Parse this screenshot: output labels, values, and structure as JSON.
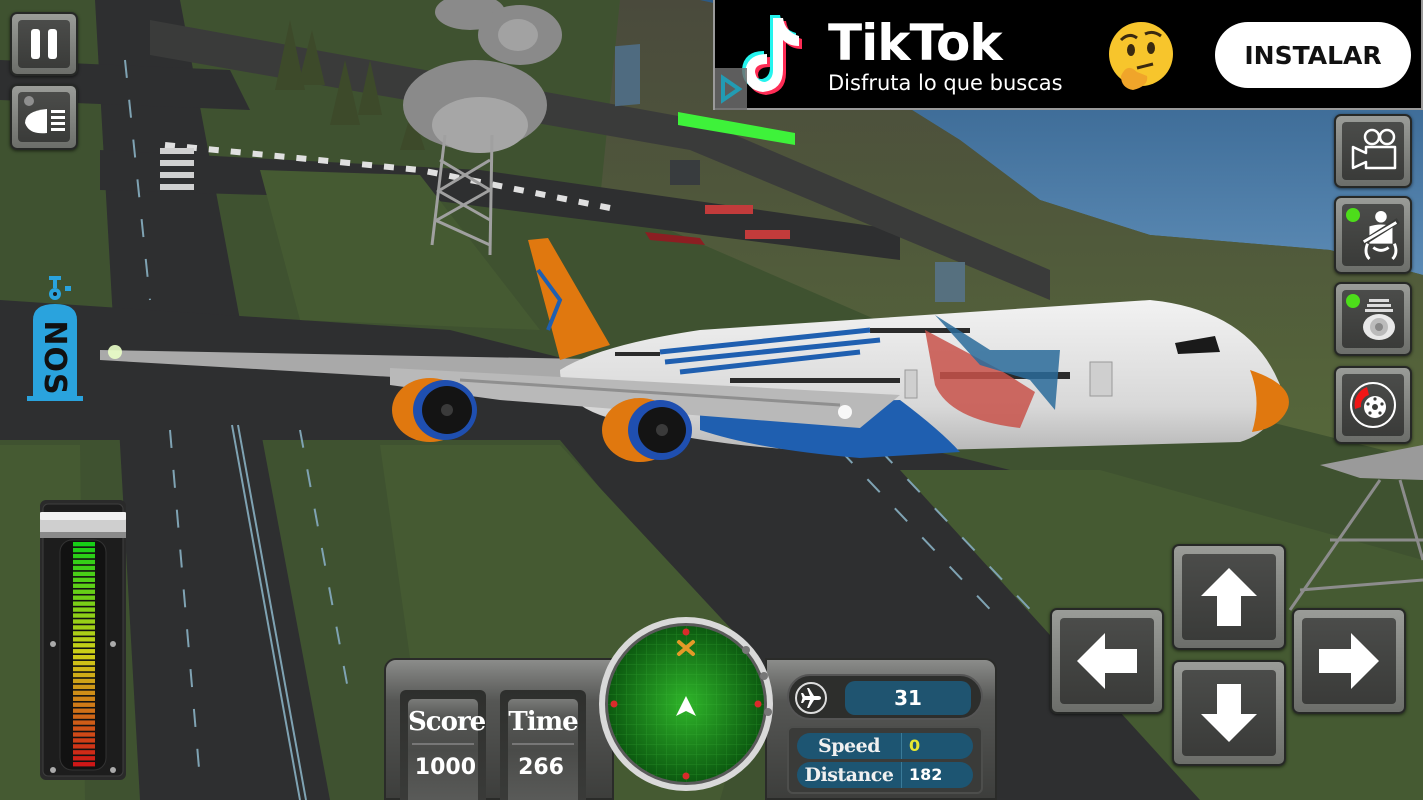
{
  "hud": {
    "pause_icon": "pause-icon",
    "headlight_icon": "headlight-icon",
    "nos_label": "NOS",
    "nos_icon": "nitro-bottle-icon",
    "throttle_level": 1.0
  },
  "ad": {
    "brand": "TikTok",
    "tagline": "Disfruta lo que buscas",
    "emoji": "thinking-face",
    "install_label": "INSTALAR",
    "logo_icon": "tiktok-logo-icon",
    "adchoices_icon": "adchoices-play-icon"
  },
  "right_controls": [
    {
      "name": "camera-button",
      "icon": "video-camera-icon",
      "active_indicator": false
    },
    {
      "name": "seatbelt-button",
      "icon": "seatbelt-icon",
      "active_indicator": true
    },
    {
      "name": "landing-gear-button",
      "icon": "landing-gear-icon",
      "active_indicator": true
    },
    {
      "name": "brake-button",
      "icon": "brake-disc-icon",
      "active_indicator": false
    }
  ],
  "dashboard": {
    "score_label": "Score",
    "score_value": "1000",
    "time_label": "Time",
    "time_value": "266",
    "altitude_value": "31",
    "speed_label": "Speed",
    "speed_value": "0",
    "distance_label": "Distance",
    "distance_value": "182"
  },
  "radar": {
    "target_marker": "x-target-icon",
    "player_marker": "player-arrow-icon"
  },
  "dpad": {
    "up": "arrow-up-icon",
    "down": "arrow-down-icon",
    "left": "arrow-left-icon",
    "right": "arrow-right-icon"
  },
  "colors": {
    "nos_blue": "#2aa3dd",
    "radar_green": "#1c8a1e",
    "info_blue": "#1d5572",
    "active_green": "#4ddd1a",
    "plane_orange": "#e0780f",
    "plane_blue": "#1f5fb0"
  }
}
